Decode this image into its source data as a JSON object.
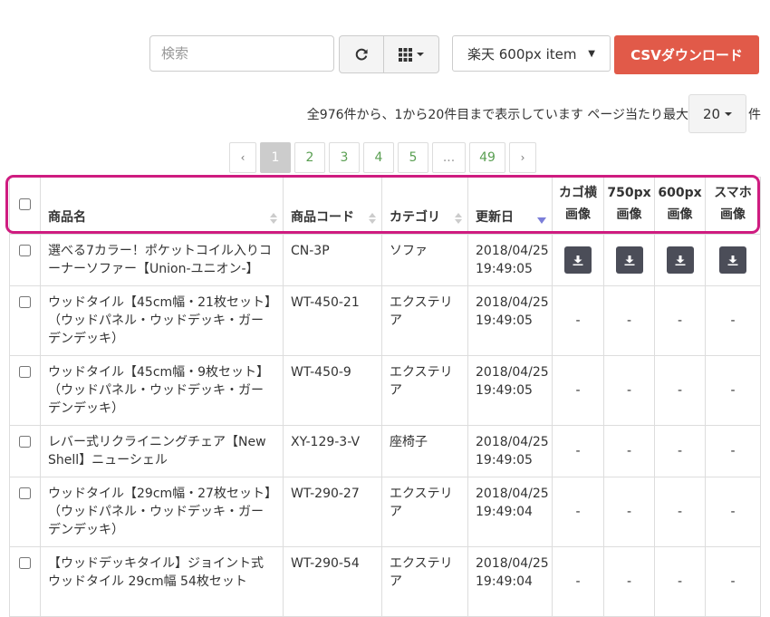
{
  "search": {
    "placeholder": "検索",
    "value": ""
  },
  "toolbar": {
    "refresh_icon": "refresh-icon",
    "columns_icon": "grid-icon",
    "select_value": "楽天 600px item",
    "csv_label": "CSVダウンロード",
    "csv_color": "#e15a49"
  },
  "info": {
    "summary": "全976件から、1から20件目まで表示しています ページ当たり最大",
    "per_page": "20",
    "unit": "件"
  },
  "pagination": {
    "prev": "‹",
    "pages": [
      "1",
      "2",
      "3",
      "4",
      "5",
      "...",
      "49"
    ],
    "active": "1",
    "next": "›"
  },
  "table": {
    "headers": {
      "name": "商品名",
      "code": "商品コード",
      "category": "カテゴリ",
      "updated": "更新日",
      "kago_1": "カゴ横",
      "kago_2": "画像",
      "px750_1": "750px",
      "px750_2": "画像",
      "px600_1": "600px",
      "px600_2": "画像",
      "sp_1": "スマホ",
      "sp_2": "画像"
    },
    "rows": [
      {
        "name": "選べる7カラー！ポケットコイル入りコーナーソファー【Union-ユニオン-】",
        "code": "CN-3P",
        "category": "ソファ",
        "date": "2018/04/25",
        "time": "19:49:05",
        "downloads": true,
        "dash": "-"
      },
      {
        "name": "ウッドタイル【45cm幅・21枚セット】（ウッドパネル・ウッドデッキ・ガーデンデッキ）",
        "code": "WT-450-21",
        "category": "エクステリア",
        "date": "2018/04/25",
        "time": "19:49:05",
        "downloads": false,
        "dash": "-"
      },
      {
        "name": "ウッドタイル【45cm幅・9枚セット】（ウッドパネル・ウッドデッキ・ガーデンデッキ）",
        "code": "WT-450-9",
        "category": "エクステリア",
        "date": "2018/04/25",
        "time": "19:49:05",
        "downloads": false,
        "dash": "-"
      },
      {
        "name": "レバー式リクライニングチェア【New Shell】ニューシェル",
        "code": "XY-129-3-V",
        "category": "座椅子",
        "date": "2018/04/25",
        "time": "19:49:05",
        "downloads": false,
        "dash": "-"
      },
      {
        "name": "ウッドタイル【29cm幅・27枚セット】（ウッドパネル・ウッドデッキ・ガーデンデッキ）",
        "code": "WT-290-27",
        "category": "エクステリア",
        "date": "2018/04/25",
        "time": "19:49:04",
        "downloads": false,
        "dash": "-"
      },
      {
        "name": "【ウッドデッキタイル】ジョイント式ウッドタイル 29cm幅 54枚セット",
        "code": "WT-290-54",
        "category": "エクステリア",
        "date": "2018/04/25",
        "time": "19:49:04",
        "downloads": false,
        "dash": "-"
      }
    ]
  },
  "colors": {
    "highlight": "#cf1c80",
    "link": "#5a9f52",
    "sort_active": "#7b7ed9",
    "download_button": "#4b4d58"
  }
}
